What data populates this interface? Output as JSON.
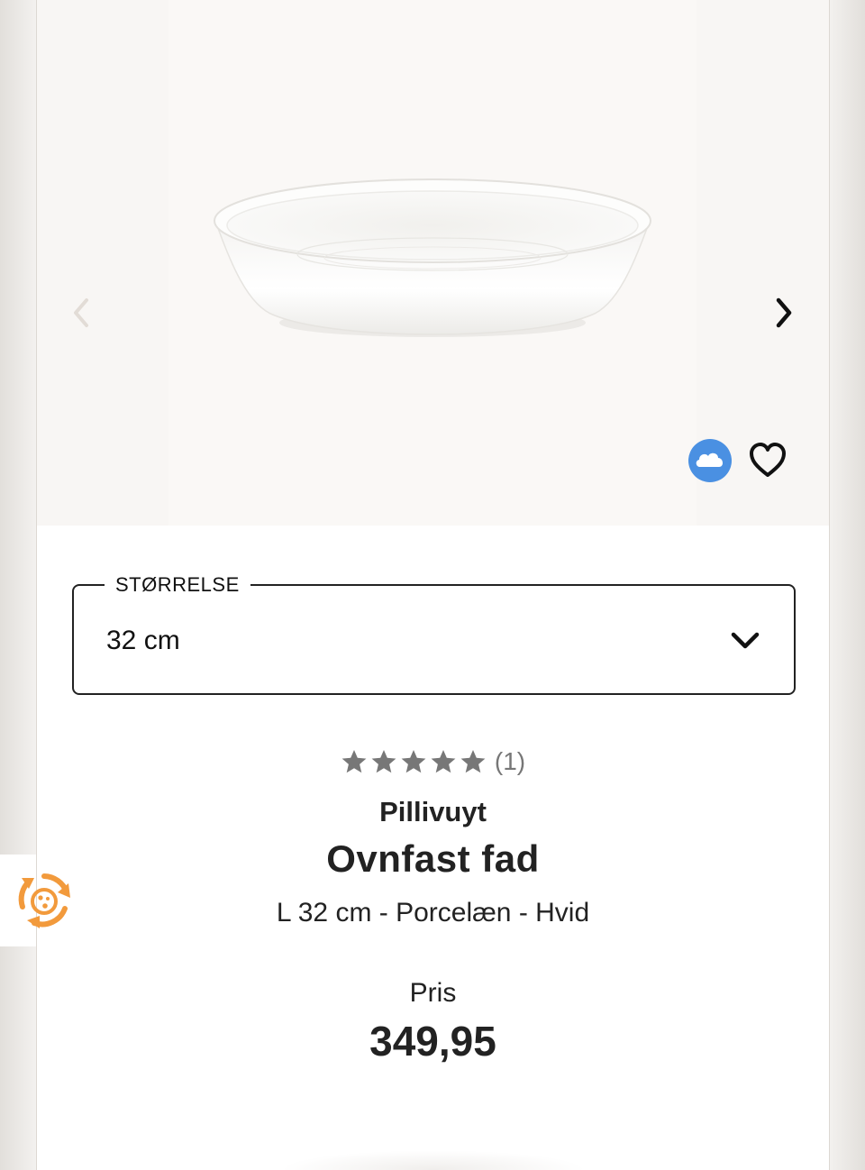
{
  "gallery": {
    "product_image": "white-oval-porcelain-dish",
    "prev_icon": "chevron-left-icon",
    "next_icon": "chevron-right-icon",
    "badge_icon": "cloud-icon",
    "favorite_icon": "heart-icon"
  },
  "size_selector": {
    "label": "STØRRELSE",
    "value": "32 cm"
  },
  "rating": {
    "stars": 5,
    "max_stars": 5,
    "count_text": "(1)"
  },
  "product": {
    "brand": "Pillivuyt",
    "title": "Ovnfast fad",
    "subtitle": "L 32 cm - Porcelæn - Hvid"
  },
  "price": {
    "label": "Pris",
    "value": "349,95"
  },
  "widget": {
    "icon": "recycle-icon"
  },
  "colors": {
    "accent_orange": "#f29a3c",
    "cloud_blue": "#4a90e2",
    "star_gray": "#777777",
    "text_dark": "#222222"
  }
}
